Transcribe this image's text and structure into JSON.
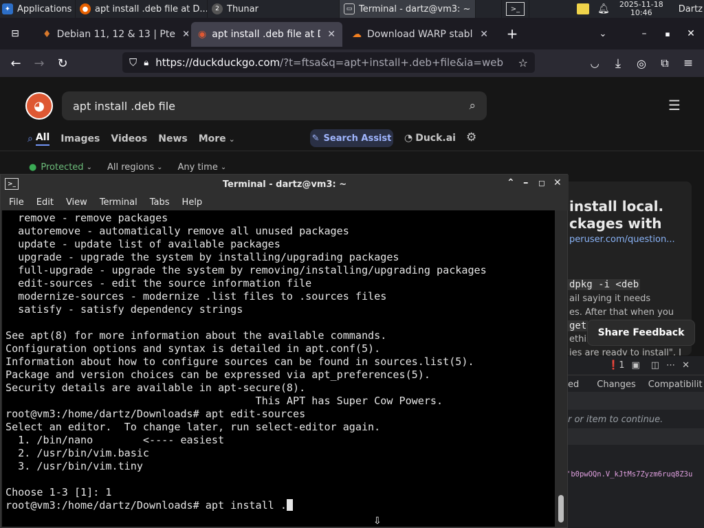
{
  "panel": {
    "applications": "Applications",
    "windows": [
      {
        "title": "apt install .deb file at D...",
        "icon": "firefox-icon"
      },
      {
        "title": "Thunar",
        "icon": "thunar-icon",
        "badge": "2"
      },
      {
        "title": "Terminal - dartz@vm3: ~",
        "icon": "terminal-icon"
      }
    ],
    "clock": [
      "2025-11-18",
      "10:46"
    ],
    "user": "Dartz"
  },
  "browser": {
    "tabs": [
      {
        "label": "Debian 11, 12 & 13 | Pte"
      },
      {
        "label": "apt install .deb file at Du"
      },
      {
        "label": "Download WARP stable r"
      }
    ],
    "url": {
      "host": "https://duckduckgo.com",
      "rest": "/?t=ftsa&q=apt+install+.deb+file&ia=web"
    }
  },
  "ddg": {
    "query": "apt install .deb file",
    "nav": [
      "All",
      "Images",
      "Videos",
      "News",
      "More"
    ],
    "assist": "Search Assist",
    "duckai": "Duck.ai",
    "filters": [
      "Protected",
      "All regions",
      "Any time"
    ],
    "result_heading": [
      "install local.",
      "ckages with"
    ],
    "result_link": "peruser.com/question...",
    "snippet_code": "dpkg -i <deb",
    "snippet": [
      "ail saying it needs",
      "es. After that when you",
      "get",
      "ethin",
      "ies are ready to install\". I"
    ],
    "feedback": "Share Feedback"
  },
  "devtools": {
    "count": "1",
    "tabs": [
      "ed",
      "Changes",
      "Compatibilit"
    ],
    "hint": "r or item to continue.",
    "hash": "'b0pwOQn.V_kJtMs7Zyzm6ruq8Z3u"
  },
  "terminal": {
    "title": "Terminal - dartz@vm3: ~",
    "menu": [
      "File",
      "Edit",
      "View",
      "Terminal",
      "Tabs",
      "Help"
    ],
    "lines": [
      "  remove - remove packages",
      "  autoremove - automatically remove all unused packages",
      "  update - update list of available packages",
      "  upgrade - upgrade the system by installing/upgrading packages",
      "  full-upgrade - upgrade the system by removing/installing/upgrading packages",
      "  edit-sources - edit the source information file",
      "  modernize-sources - modernize .list files to .sources files",
      "  satisfy - satisfy dependency strings",
      "",
      "See apt(8) for more information about the available commands.",
      "Configuration options and syntax is detailed in apt.conf(5).",
      "Information about how to configure sources can be found in sources.list(5).",
      "Package and version choices can be expressed via apt_preferences(5).",
      "Security details are available in apt-secure(8).",
      "                                        This APT has Super Cow Powers.",
      "root@vm3:/home/dartz/Downloads# apt edit-sources",
      "Select an editor.  To change later, run select-editor again.",
      "  1. /bin/nano        <---- easiest",
      "  2. /usr/bin/vim.basic",
      "  3. /usr/bin/vim.tiny",
      "",
      "Choose 1-3 [1]: 1",
      "root@vm3:/home/dartz/Downloads# apt install ."
    ]
  }
}
